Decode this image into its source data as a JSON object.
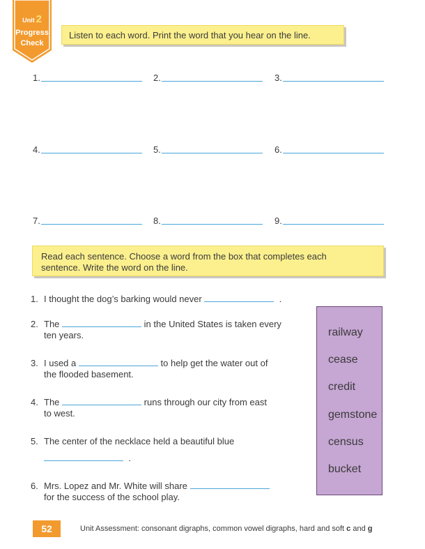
{
  "badge": {
    "unit_label": "Unit",
    "unit_number": "2",
    "line1": "Progress",
    "line2": "Check"
  },
  "part1": {
    "instruction": "Listen to each word. Print the word that you hear on the line.",
    "items": [
      "1.",
      "2.",
      "3.",
      "4.",
      "5.",
      "6.",
      "7.",
      "8.",
      "9."
    ]
  },
  "part2": {
    "instruction_line1": "Read each sentence. Choose a word from the box that completes each",
    "instruction_line2": "sentence. Write the word on the line.",
    "sentences": [
      {
        "num": "1.",
        "a": "I thought the dog’s barking would never",
        "b": "."
      },
      {
        "num": "2.",
        "a": "The",
        "b": "in the United States is taken every",
        "c": "ten years."
      },
      {
        "num": "3.",
        "a": "I used a",
        "b": "to help get the water out of",
        "c": "the flooded basement."
      },
      {
        "num": "4.",
        "a": "The",
        "b": "runs through our city from east",
        "c": "to west."
      },
      {
        "num": "5.",
        "a": "The center of the necklace held a beautiful blue",
        "b": "."
      },
      {
        "num": "6.",
        "a": "Mrs. Lopez and Mr. White will share",
        "c": "for the success of the school play."
      }
    ],
    "word_box": [
      "railway",
      "cease",
      "credit",
      "gemstone",
      "census",
      "bucket"
    ]
  },
  "footer": {
    "page_number": "52",
    "text": "Unit Assessment: consonant digraphs, common vowel digraphs, hard and soft",
    "c": "c",
    "and": "and",
    "g": "g"
  },
  "colors": {
    "badge_orange": "#f29a2e",
    "instruction_yellow": "#fcf08e",
    "answer_line_blue": "#4aa6d9",
    "word_box_purple": "#c6a6d3"
  }
}
